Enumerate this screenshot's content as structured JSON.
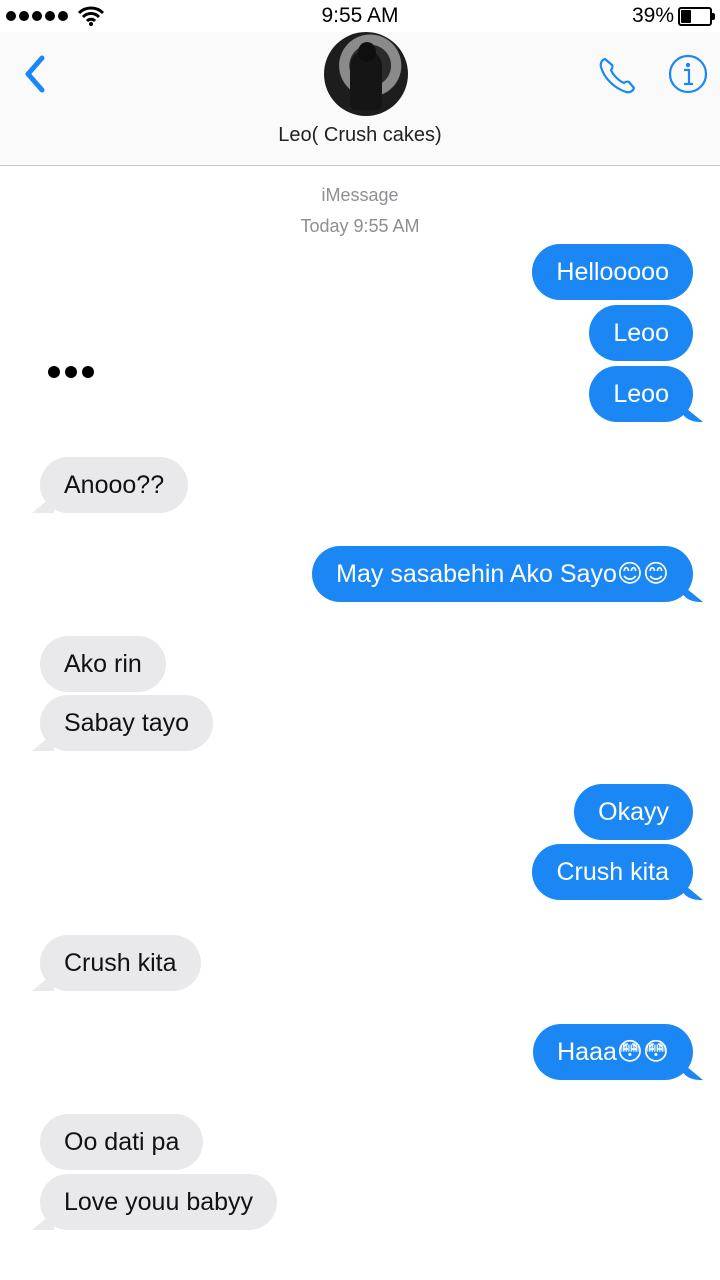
{
  "status_bar": {
    "time": "9:55 AM",
    "battery": "39%"
  },
  "header": {
    "contact_name": "Leo( Crush cakes)"
  },
  "thread": {
    "service": "iMessage",
    "timestamp": "Today 9:55 AM"
  },
  "messages": [
    {
      "from": "me",
      "text": "Hellooooo"
    },
    {
      "from": "me",
      "text": "Leoo"
    },
    {
      "from": "me",
      "text": "Leoo"
    },
    {
      "from": "them",
      "text": "Anooo??"
    },
    {
      "from": "me",
      "text": "May sasabehin Ako Sayo😊😊"
    },
    {
      "from": "them",
      "text": "Ako rin"
    },
    {
      "from": "them",
      "text": "Sabay tayo"
    },
    {
      "from": "me",
      "text": "Okayy"
    },
    {
      "from": "me",
      "text": "Crush kita"
    },
    {
      "from": "them",
      "text": "Crush kita"
    },
    {
      "from": "me",
      "text": "Haaa😳😳"
    },
    {
      "from": "them",
      "text": "Oo dati pa"
    },
    {
      "from": "them",
      "text": "Love youu babyy"
    }
  ],
  "colors": {
    "outgoing": "#1a87f5",
    "incoming": "#e9e9eb",
    "accent": "#1a87f5"
  },
  "icons": [
    "back-chevron",
    "phone",
    "info",
    "wifi",
    "battery"
  ]
}
